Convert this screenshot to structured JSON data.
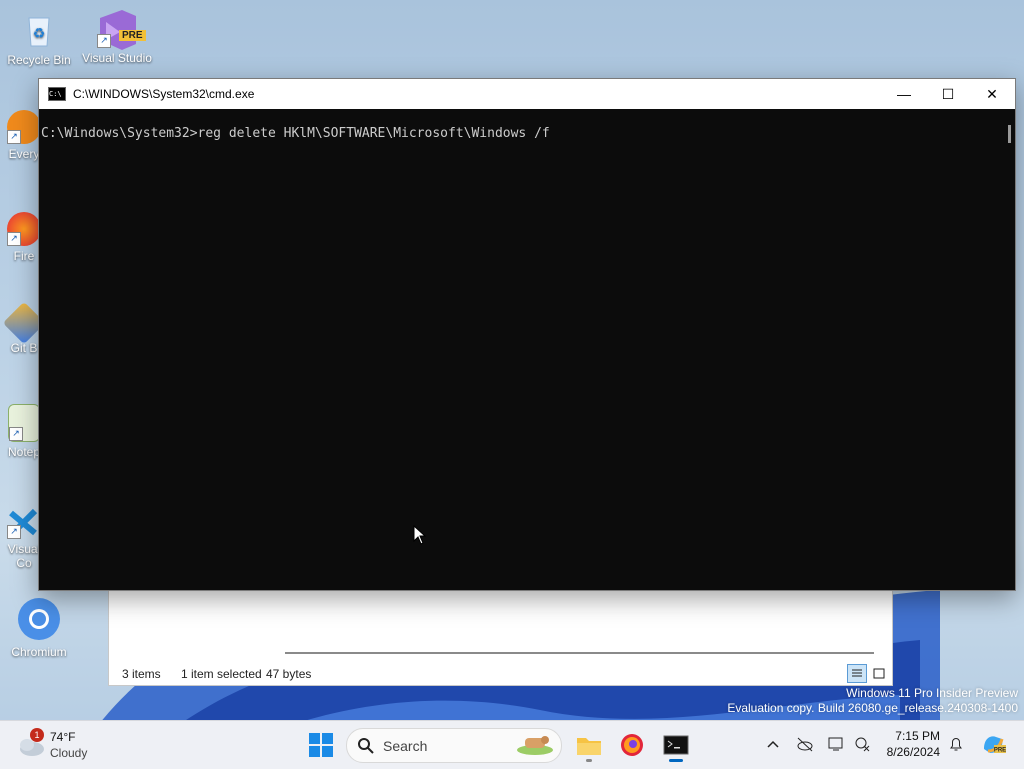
{
  "desktop": {
    "icons": [
      {
        "label": "Recycle Bin",
        "icon": "recycle-bin-icon"
      },
      {
        "label": "Visual Studio",
        "badge": "PRE",
        "icon": "visual-studio-icon"
      },
      {
        "label": "Every",
        "icon": "everything-icon"
      },
      {
        "label": "Fire",
        "icon": "firefox-icon"
      },
      {
        "label": "Git B",
        "icon": "git-bash-icon"
      },
      {
        "label": "Notep",
        "icon": "notepad-plus-icon"
      },
      {
        "label": "Visual",
        "label2": "Co",
        "icon": "vscode-icon"
      },
      {
        "label": "Chromium",
        "icon": "chromium-icon"
      }
    ]
  },
  "cmd": {
    "title": "C:\\WINDOWS\\System32\\cmd.exe",
    "icon_text": "C:\\",
    "minimize": "—",
    "maximize": "☐",
    "close": "✕",
    "console_text": "C:\\Windows\\System32>reg delete HKlM\\SOFTWARE\\Microsoft\\Windows /f"
  },
  "explorer": {
    "items_count": "3 items",
    "selection": "1 item selected",
    "size": "47 bytes"
  },
  "watermark": {
    "line1": "Windows 11 Pro Insider Preview",
    "line2": "Evaluation copy. Build 26080.ge_release.240308-1400"
  },
  "taskbar": {
    "weather_temp": "74°F",
    "weather_desc": "Cloudy",
    "weather_badge": "1",
    "search_label": "Search",
    "time": "7:15 PM",
    "date": "8/26/2024",
    "accent": "#0067c0"
  }
}
